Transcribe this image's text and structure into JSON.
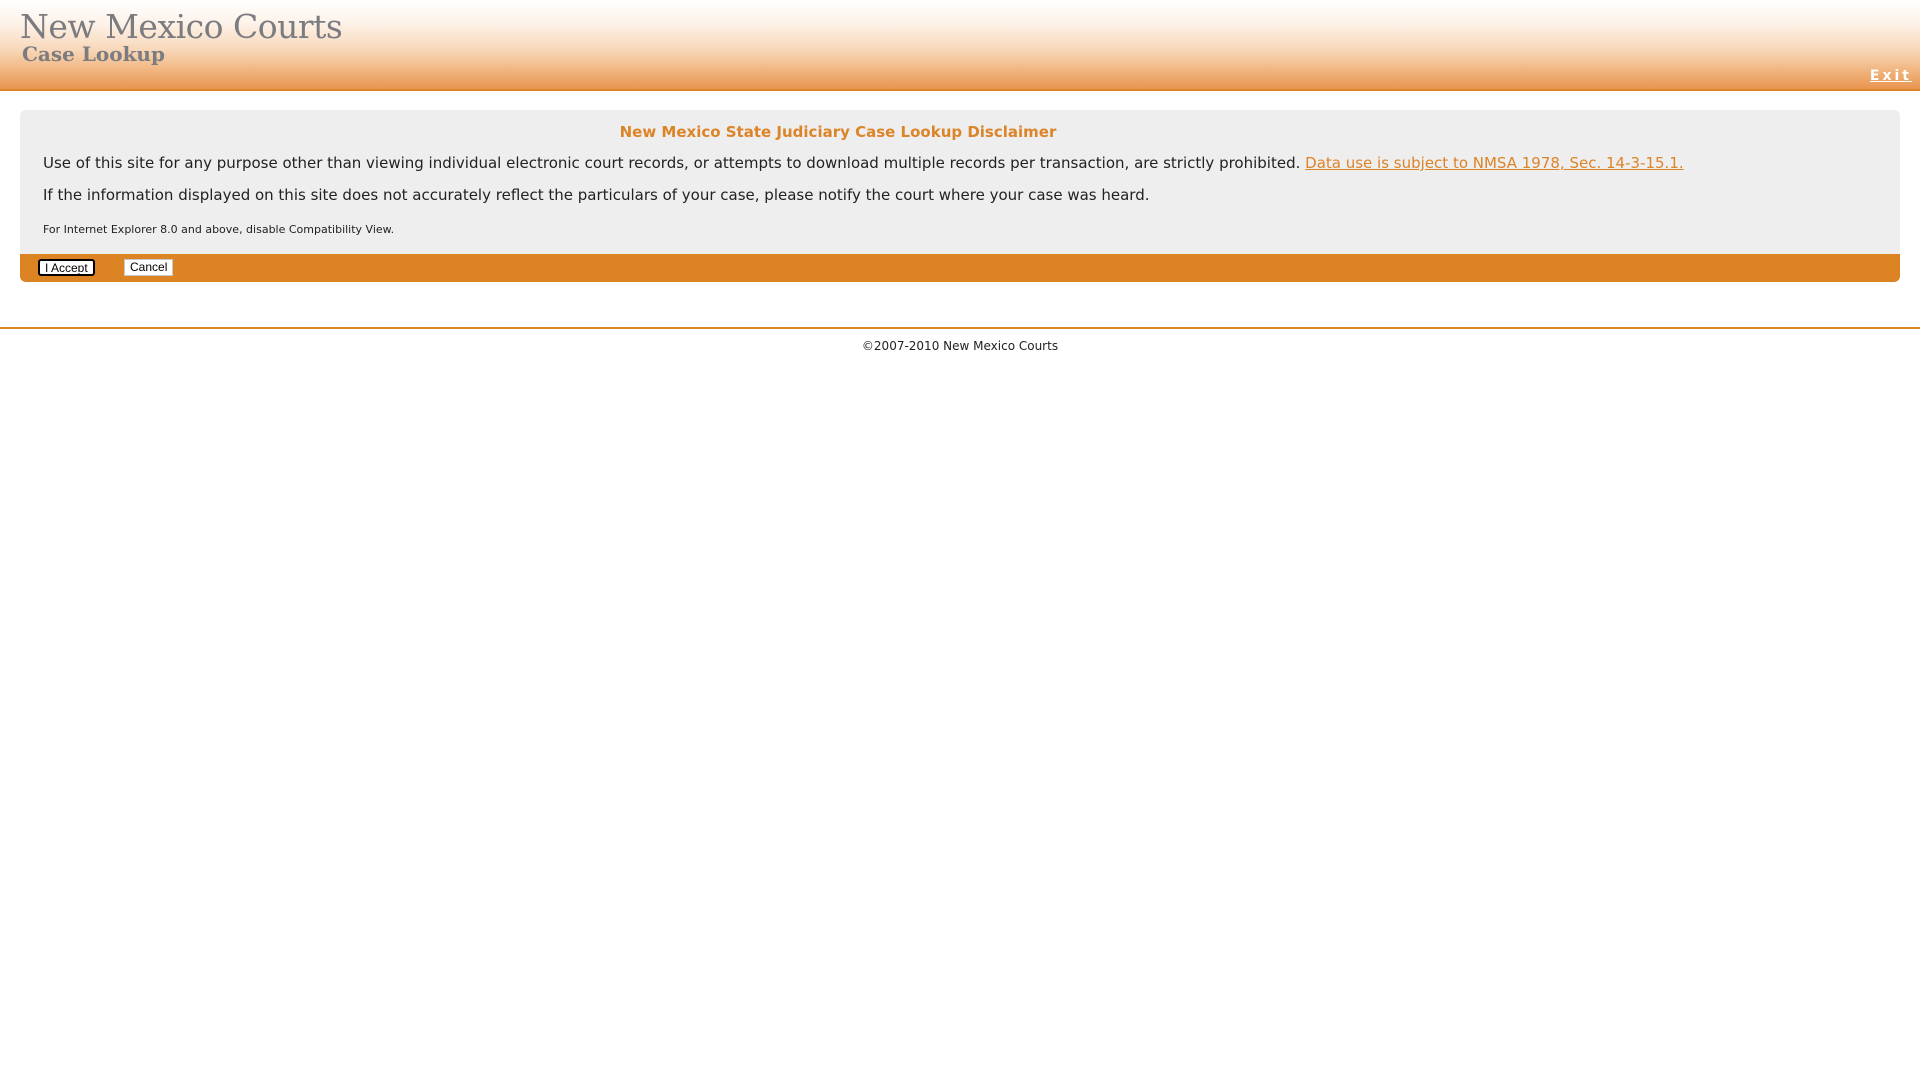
{
  "header": {
    "title": "New Mexico Courts",
    "subtitle": "Case Lookup",
    "exit_label": "Exit"
  },
  "disclaimer": {
    "title": "New Mexico State Judiciary Case Lookup Disclaimer",
    "paragraph1": "Use of this site for any purpose other than viewing individual electronic court records, or attempts to download multiple records per transaction, are strictly prohibited.",
    "paragraph1_link": "Data use is subject to NMSA 1978, Sec. 14-3-15.1.",
    "paragraph2": "If the information displayed on this site does not accurately reflect the particulars of your case, please notify the court where your case was heard.",
    "note": "For Internet Explorer 8.0 and above, disable Compatibility View."
  },
  "actions": {
    "accept_label": "I Accept",
    "cancel_label": "Cancel"
  },
  "footer": {
    "copyright": "©2007-2010 New Mexico Courts"
  },
  "colors": {
    "accent": "#dc8428",
    "panel_bg": "#eeeeee",
    "logo_text": "#7c7c80"
  }
}
